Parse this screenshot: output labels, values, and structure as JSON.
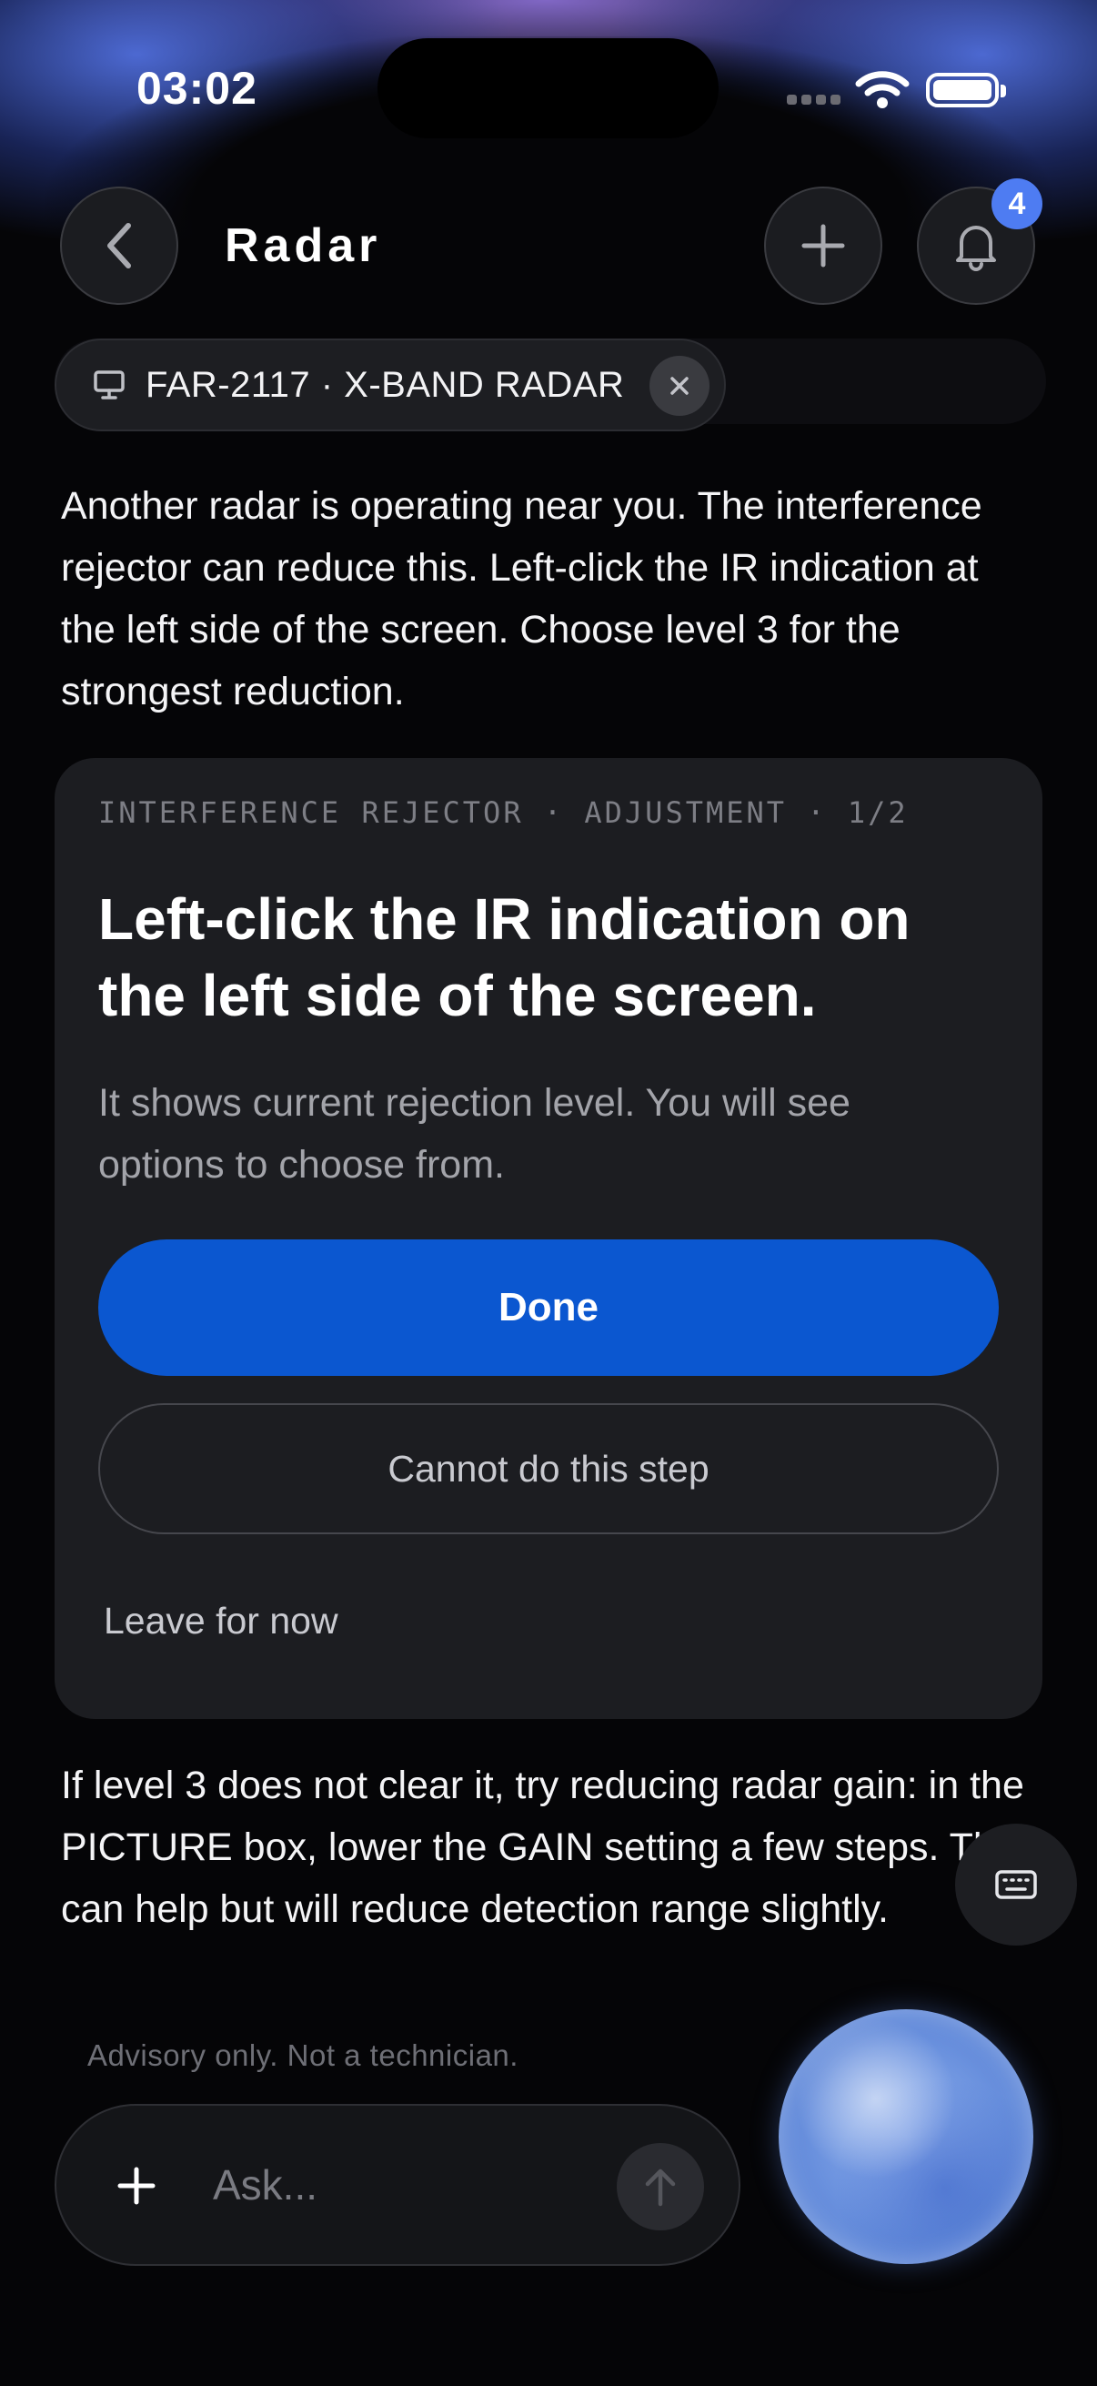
{
  "status_bar": {
    "time": "03:02"
  },
  "header": {
    "title": "Radar",
    "notification_count": "4"
  },
  "device_chip": {
    "label": "FAR-2117 · X-BAND RADAR"
  },
  "messages": {
    "intro": "Another radar is operating near you. The interference rejector can reduce this. Left-click the IR indication at the left side of the screen. Choose level 3 for the strongest reduction.",
    "followup": "If level 3 does not clear it, try reducing radar gain: in the PICTURE box, lower the GAIN setting a few steps. This can help but will reduce detection range slightly."
  },
  "step_card": {
    "eyebrow": "INTERFERENCE REJECTOR · ADJUSTMENT · 1/2",
    "title": "Left-click the IR indication on the left side of the screen.",
    "subtitle": "It shows current rejection level. You will see options to choose from.",
    "done_label": "Done",
    "cannot_label": "Cannot do this step",
    "leave_label": "Leave for now"
  },
  "footer": {
    "advisory": "Advisory only. Not a technician.",
    "input_placeholder": "Ask..."
  },
  "colors": {
    "accent": "#0b57d0",
    "badge": "#4e7cf2",
    "background": "#050507",
    "card": "#1c1d21"
  },
  "icons": [
    "back-chevron-icon",
    "plus-icon",
    "bell-icon",
    "monitor-icon",
    "close-icon",
    "keyboard-icon",
    "arrow-up-icon",
    "voice-orb"
  ]
}
